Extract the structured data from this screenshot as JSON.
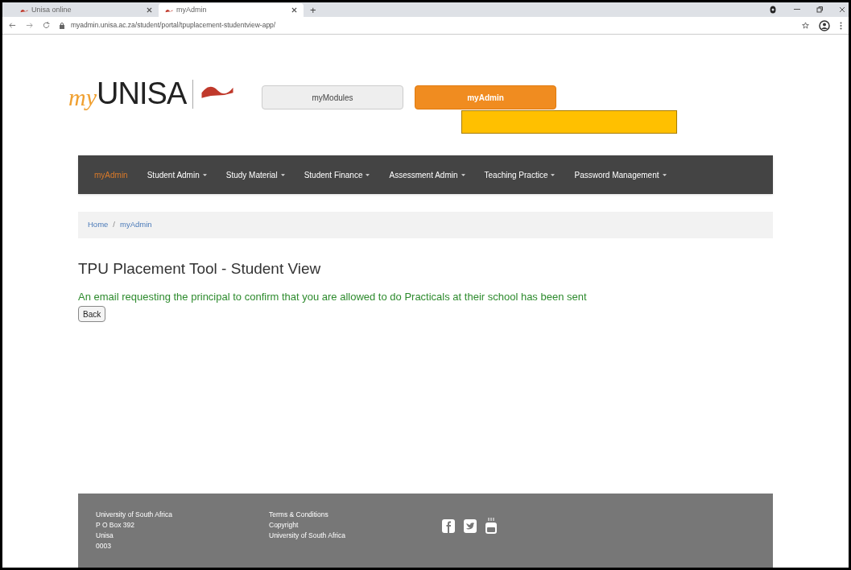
{
  "browser": {
    "tabs": [
      {
        "title": "Unisa online",
        "selected": false
      },
      {
        "title": "myAdmin",
        "selected": true
      }
    ],
    "new_tab": "+",
    "url": "myadmin.unisa.ac.za/student/portal/tpuplacement-studentview-app/"
  },
  "header": {
    "logo_prefix": "my",
    "logo_name": "UNISA",
    "portal_buttons": [
      {
        "label": "myModules",
        "selected": false
      },
      {
        "label": "myAdmin",
        "selected": true
      }
    ]
  },
  "nav": [
    {
      "label": "myAdmin",
      "selected": true,
      "dropdown": false
    },
    {
      "label": "Student Admin",
      "selected": false,
      "dropdown": true
    },
    {
      "label": "Study Material",
      "selected": false,
      "dropdown": true
    },
    {
      "label": "Student Finance",
      "selected": false,
      "dropdown": true
    },
    {
      "label": "Assessment Admin",
      "selected": false,
      "dropdown": true
    },
    {
      "label": "Teaching Practice",
      "selected": false,
      "dropdown": true
    },
    {
      "label": "Password Management",
      "selected": false,
      "dropdown": true
    }
  ],
  "breadcrumb": [
    {
      "label": "Home"
    },
    {
      "label": "myAdmin"
    }
  ],
  "breadcrumb_separator": "/",
  "page": {
    "title": "TPU Placement Tool - Student View",
    "message": "An email requesting the principal to confirm that you are allowed to do Practicals at their school has been sent",
    "back_button": "Back"
  },
  "footer": {
    "address": [
      "University of South Africa",
      "P O Box 392",
      "Unisa",
      "0003"
    ],
    "links": [
      "Terms & Conditions",
      "Copyright",
      "University of South Africa"
    ]
  }
}
